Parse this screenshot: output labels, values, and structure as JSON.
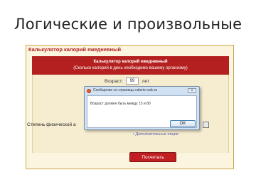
{
  "slide": {
    "title": "Логические и произвольные"
  },
  "calculator": {
    "header": "Калькулятор калорий ежедневный",
    "band_title": "Калькулятор калорий ежедневный",
    "band_subtitle": "(Сколько калорий в день необходимо вашему организму)",
    "age_label": "Возраст:",
    "age_value": "99",
    "age_unit": "лет",
    "activity_label": "Степень физической а",
    "behind_link": "• Дополнительные опции",
    "submit_label": "Посчитать"
  },
  "dialog": {
    "title": "Сообщение со страницы calorie-calc.ru",
    "close_label": "×",
    "message": "Возраст должен быть между 15 и 80",
    "ok_label": "OK"
  }
}
